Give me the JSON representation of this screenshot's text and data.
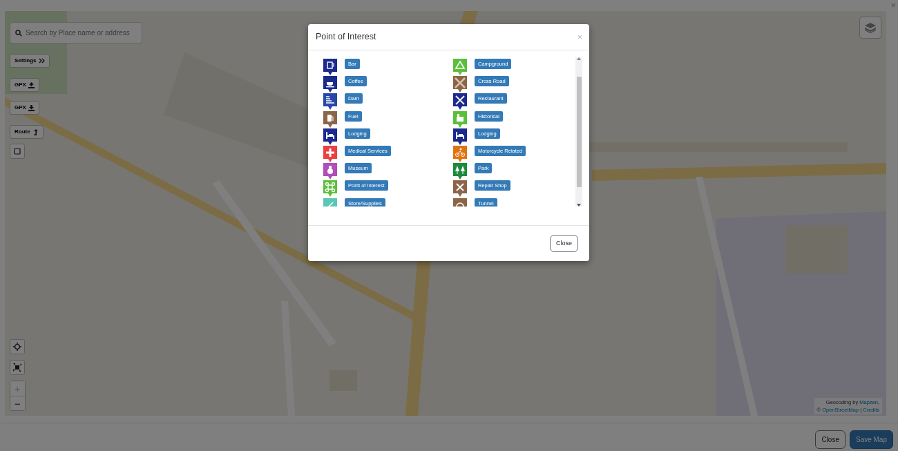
{
  "page_close": "×",
  "search": {
    "placeholder": "Search by Place name or address"
  },
  "map_buttons": [
    {
      "kind": "settings",
      "label": "Settings"
    },
    {
      "kind": "upload",
      "label": "GPX"
    },
    {
      "kind": "download",
      "label": "GPX"
    },
    {
      "kind": "route",
      "label": "Route"
    },
    {
      "kind": "square"
    }
  ],
  "map_controls": [
    {
      "kind": "locate"
    },
    {
      "kind": "fullscreen"
    }
  ],
  "zoom": [
    {
      "label": "+",
      "disabled": true
    },
    {
      "label": "−",
      "disabled": false
    }
  ],
  "attribution": {
    "lead": "Geocoding by",
    "geocoder": "Mapzen",
    "comma": ",",
    "copyright": "©",
    "map_source": "OpenStreetMap",
    "separator": "|",
    "credits": "Credits"
  },
  "modal": {
    "title": "Point of Interest",
    "close": "×",
    "categories": [
      {
        "label": "Bar",
        "kind": "bar",
        "color": "#1b2a8c"
      },
      {
        "label": "Campground",
        "kind": "tent",
        "color": "#5cbf3c"
      },
      {
        "label": "Coffee",
        "kind": "cup",
        "color": "#1b2a8c"
      },
      {
        "label": "Cross Road",
        "kind": "cross-road",
        "color": "#8c6548"
      },
      {
        "label": "Dam",
        "kind": "dam",
        "color": "#2848a8"
      },
      {
        "label": "Restaurant",
        "kind": "cutlery",
        "color": "#1b2a8c"
      },
      {
        "label": "Fuel",
        "kind": "fuel",
        "color": "#8c6548"
      },
      {
        "label": "Historical",
        "kind": "building",
        "color": "#5cbf3c"
      },
      {
        "label": "Lodging",
        "kind": "bed",
        "color": "#1b2a8c"
      },
      {
        "label": "Lodging",
        "kind": "bed",
        "color": "#1b2a8c"
      },
      {
        "label": "Medical Services",
        "kind": "plus",
        "color": "#e8413f"
      },
      {
        "label": "Motorcycle Related",
        "kind": "bike",
        "color": "#e07510"
      },
      {
        "label": "Museum",
        "kind": "vase",
        "color": "#b04fb8"
      },
      {
        "label": "Park",
        "kind": "trees",
        "color": "#1e8a3c"
      },
      {
        "label": "Point of Interest",
        "kind": "command",
        "color": "#5cbf3c"
      },
      {
        "label": "Repair Shop",
        "kind": "tools",
        "color": "#8c6548"
      },
      {
        "label": "Store/Supplies",
        "kind": "bag",
        "color": "#5cc6b4"
      },
      {
        "label": "Tunnel",
        "kind": "ring",
        "color": "#8c6548"
      }
    ],
    "footer_button": "Close"
  },
  "footer_buttons": [
    {
      "kind": "close",
      "label": "Close"
    },
    {
      "kind": "save",
      "label": "Save Map"
    }
  ]
}
